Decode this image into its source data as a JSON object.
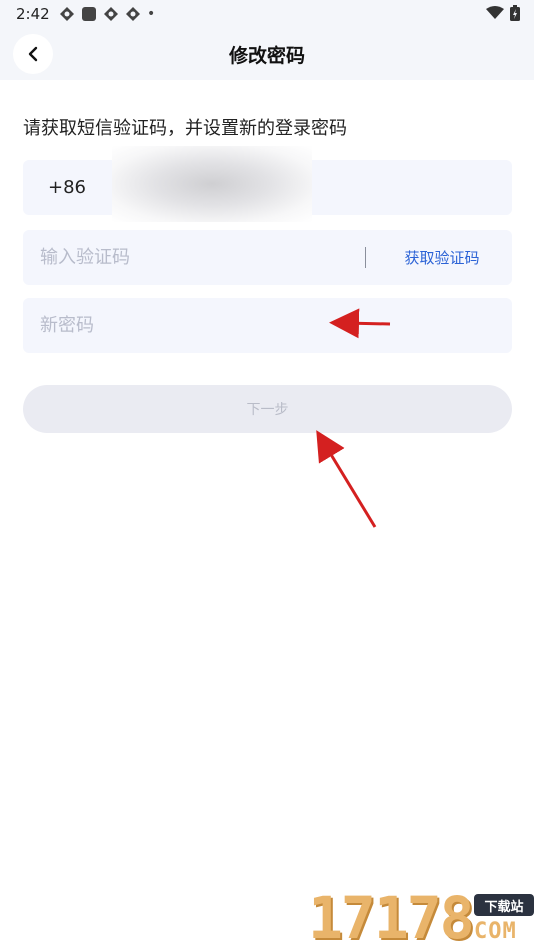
{
  "status_bar": {
    "time": "2:42",
    "dot": "•"
  },
  "header": {
    "title": "修改密码",
    "back_icon": "chevron-left-icon"
  },
  "form": {
    "hint": "请获取短信验证码，并设置新的登录密码",
    "phone_code": "+86",
    "phone_value": "",
    "code_placeholder": "输入验证码",
    "get_code_label": "获取验证码",
    "password_placeholder": "新密码",
    "next_label": "下一步"
  },
  "colors": {
    "accent": "#2c63d6",
    "annotation_arrow": "#d42020",
    "field_bg": "#f4f6fd",
    "button_disabled_bg": "#eaebf2"
  },
  "watermark": {
    "number": "17178",
    "tag": "下载站",
    "domain": "COM"
  }
}
